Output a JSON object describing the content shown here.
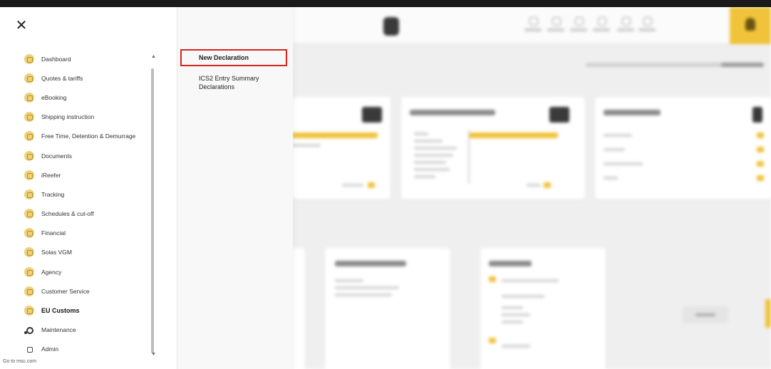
{
  "menu": {
    "close_icon": "close-icon",
    "items": [
      {
        "label": "Dashboard",
        "icon": "dashboard-icon"
      },
      {
        "label": "Quotes & tariffs",
        "icon": "quotes-icon"
      },
      {
        "label": "eBooking",
        "icon": "booking-icon"
      },
      {
        "label": "Shipping instruction",
        "icon": "shipping-instruction-icon"
      },
      {
        "label": "Free Time, Detention & Demurrage",
        "icon": "free-time-icon"
      },
      {
        "label": "Documents",
        "icon": "documents-icon"
      },
      {
        "label": "iReefer",
        "icon": "reefer-icon"
      },
      {
        "label": "Tracking",
        "icon": "tracking-icon"
      },
      {
        "label": "Schedules & cut-off",
        "icon": "schedules-icon"
      },
      {
        "label": "Financial",
        "icon": "financial-icon"
      },
      {
        "label": "Solas VGM",
        "icon": "solas-vgm-icon"
      },
      {
        "label": "Agency",
        "icon": "agency-icon"
      },
      {
        "label": "Customer Service",
        "icon": "customer-service-icon"
      },
      {
        "label": "EU Customs",
        "icon": "eu-customs-icon",
        "active": true
      },
      {
        "label": "Maintenance",
        "icon": "maintenance-icon"
      },
      {
        "label": "Admin",
        "icon": "admin-icon"
      }
    ],
    "footer_link": "Go to msc.com"
  },
  "submenu": {
    "items": [
      {
        "label": "New Declaration",
        "selected": true
      },
      {
        "label": "ICS2 Entry Summary Declarations"
      }
    ]
  },
  "colors": {
    "accent": "#f0c33a",
    "icon_bg": "#efd07a",
    "highlight_border": "#d6261c"
  }
}
